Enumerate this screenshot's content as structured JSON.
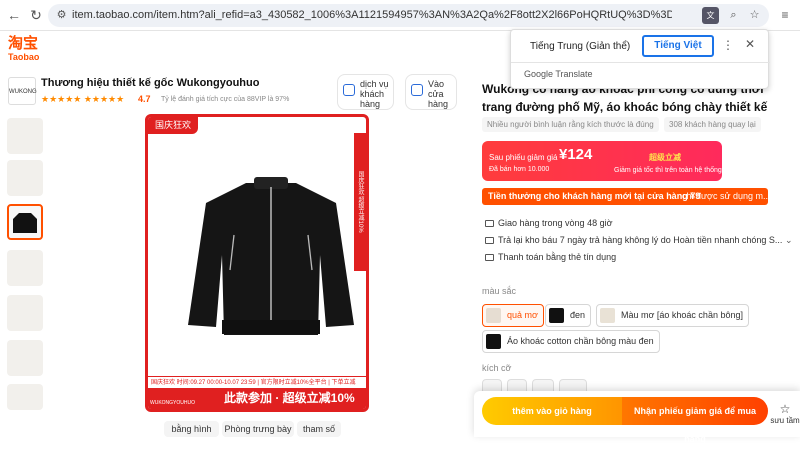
{
  "browser": {
    "url": "item.taobao.com/item.htm?ali_refid=a3_430582_1006%3A1121594957%3AN%3A2Qa%2F8ott2X2l66PoHQRtUQ%3D%3D%3A47d908a31e280e...",
    "back_icon": "arrow-left-icon",
    "forward_icon": "arrow-right-icon",
    "reload_icon": "reload-icon"
  },
  "logo": {
    "text": "淘宝",
    "sub": "Taobao"
  },
  "shop": {
    "avatar_text": "WUKONG",
    "name": "Thương hiệu thiết kế gốc Wukongyouhuo",
    "stars": "★★★★★ ★★★★★",
    "score": "4.7",
    "note": "Tỷ lệ đánh giá tích cực của 88VIP là 97%",
    "btn_service": "dịch vụ khách hàng",
    "btn_store": "Vào cửa hàng"
  },
  "image": {
    "banner_top": "国庆狂欢",
    "side_strip": "国庆狂欢 超级立减10%",
    "promo_line": "国庆狂欢 时间:09.27 00:00-10.07 23:59 | 官方限时立减10%全平台 | 下单立减",
    "bottom_text": "此款参加 · 超级立减10%",
    "brand": "WUKONGYOUHUO"
  },
  "tabs": [
    "bằng hình",
    "Phòng trưng bày",
    "tham số"
  ],
  "product": {
    "title": "Wukong có hàng áo khoác phi công có dung thời trang đường phố Mỹ, áo khoác bóng chày thiết kế khóa kéo ...",
    "tags": [
      "Nhiều người bình luận rằng kích thước là đúng",
      "308 khách hàng quay lại"
    ],
    "price_label": "Sau phiếu giảm giá",
    "price": "¥124",
    "sold": "Đã bán hơn 10.000",
    "promo_tag": "超级立减",
    "promo_note": "Giảm giá tốc thì trên toàn hệ thống",
    "coupon_bold": "Tiền thưởng cho khách hàng mới tại cửa hàng ¥9",
    "coupon_rest": "chỉ được sử dụng m...",
    "services": [
      "Giao hàng trong vòng 48 giờ",
      "Trả lại kho báu     7 ngày trả hàng không lý do     Hoàn tiền nhanh chóng     S...",
      "Thanh toán bằng thẻ tín dụng"
    ],
    "color_label": "màu sắc",
    "colors": [
      "quả mơ",
      "đen",
      "Màu mơ [áo khoác chần bông]",
      "Áo khoác cotton chần bông màu đen"
    ],
    "size_label": "kích cỡ",
    "cart_btn": "thêm vào giỏ hàng",
    "buy_btn": "Nhận phiếu giảm giá để mua hàng",
    "fav_label": "sưu tầm"
  },
  "translate": {
    "source": "Tiếng Trung (Giản thể)",
    "target": "Tiếng Việt",
    "brand": "Google Translate"
  }
}
